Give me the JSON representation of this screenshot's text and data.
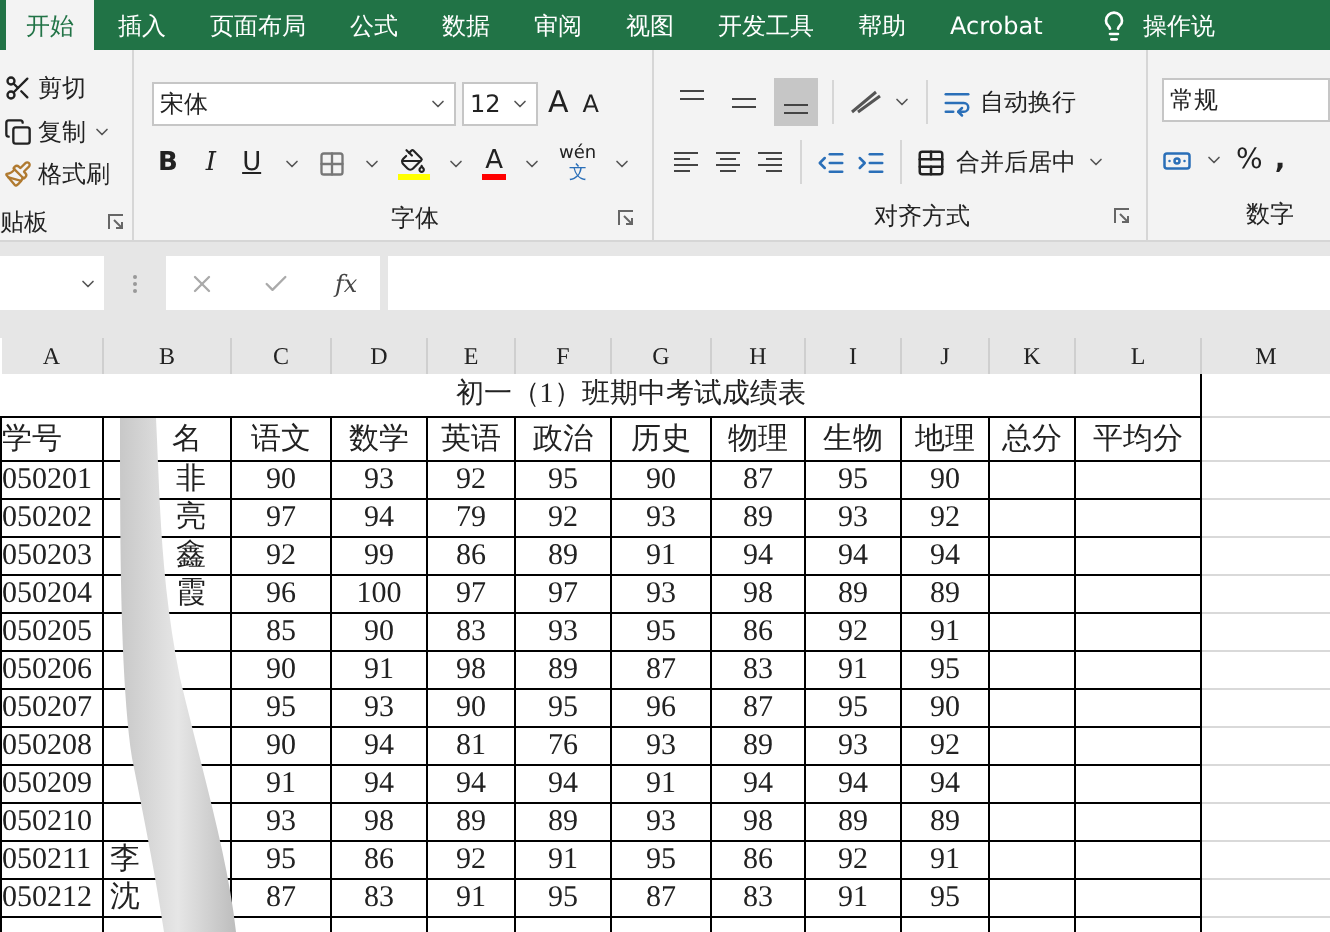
{
  "ribbon_tabs": [
    {
      "label": "开始",
      "selected": true
    },
    {
      "label": "插入",
      "selected": false
    },
    {
      "label": "页面布局",
      "selected": false
    },
    {
      "label": "公式",
      "selected": false
    },
    {
      "label": "数据",
      "selected": false
    },
    {
      "label": "审阅",
      "selected": false
    },
    {
      "label": "视图",
      "selected": false
    },
    {
      "label": "开发工具",
      "selected": false
    },
    {
      "label": "帮助",
      "selected": false
    },
    {
      "label": "Acrobat",
      "selected": false
    }
  ],
  "tell_me": "操作说",
  "clipboard": {
    "buttons": [
      "剪切",
      "复制",
      "格式刷"
    ],
    "label": "贴板"
  },
  "font": {
    "family": "宋体",
    "size": "12",
    "grow": "A",
    "shrink": "A",
    "bold": "B",
    "italic": "I",
    "underline": "U",
    "font_color": "A",
    "phonetic_top": "wén",
    "phonetic_bottom": "文",
    "label": "字体"
  },
  "alignment": {
    "vertical": [
      {
        "selected": false
      },
      {
        "selected": false
      },
      {
        "selected": true
      }
    ],
    "wrap": "自动换行",
    "merge": "合并后居中",
    "label": "对齐方式"
  },
  "number": {
    "format": "常规",
    "percent": "%",
    "comma": ",",
    "label": "数字"
  },
  "formula_bar": {
    "fx": "fx"
  },
  "columns": [
    "A",
    "B",
    "C",
    "D",
    "E",
    "F",
    "G",
    "H",
    "I",
    "J",
    "K",
    "L",
    "M"
  ],
  "sheet": {
    "title": "初一（1）班期中考试成绩表",
    "headers": [
      "学号",
      "名",
      "语文",
      "数学",
      "英语",
      "政治",
      "历史",
      "物理",
      "生物",
      "地理",
      "总分",
      "平均分"
    ],
    "rows": [
      {
        "id": "050201",
        "name": "非",
        "scores": [
          "90",
          "93",
          "92",
          "95",
          "90",
          "87",
          "95",
          "90"
        ]
      },
      {
        "id": "050202",
        "name": "亮",
        "scores": [
          "97",
          "94",
          "79",
          "92",
          "93",
          "89",
          "93",
          "92"
        ]
      },
      {
        "id": "050203",
        "name": "鑫",
        "scores": [
          "92",
          "99",
          "86",
          "89",
          "91",
          "94",
          "94",
          "94"
        ]
      },
      {
        "id": "050204",
        "name": "霞",
        "scores": [
          "96",
          "100",
          "97",
          "97",
          "93",
          "98",
          "89",
          "89"
        ]
      },
      {
        "id": "050205",
        "scores": [
          "85",
          "90",
          "83",
          "93",
          "95",
          "86",
          "92",
          "91"
        ]
      },
      {
        "id": "050206",
        "scores": [
          "90",
          "91",
          "98",
          "89",
          "87",
          "83",
          "91",
          "95"
        ]
      },
      {
        "id": "050207",
        "scores": [
          "95",
          "93",
          "90",
          "95",
          "96",
          "87",
          "95",
          "90"
        ]
      },
      {
        "id": "050208",
        "scores": [
          "90",
          "94",
          "81",
          "76",
          "93",
          "89",
          "93",
          "92"
        ]
      },
      {
        "id": "050209",
        "scores": [
          "91",
          "94",
          "94",
          "94",
          "91",
          "94",
          "94",
          "94"
        ]
      },
      {
        "id": "050210",
        "scores": [
          "93",
          "98",
          "89",
          "89",
          "93",
          "98",
          "89",
          "89"
        ]
      },
      {
        "id": "050211",
        "name": "李",
        "scores": [
          "95",
          "86",
          "92",
          "91",
          "95",
          "86",
          "92",
          "91"
        ]
      },
      {
        "id": "050212",
        "name": "沈",
        "scores": [
          "87",
          "83",
          "91",
          "95",
          "87",
          "83",
          "91",
          "95"
        ]
      }
    ]
  }
}
